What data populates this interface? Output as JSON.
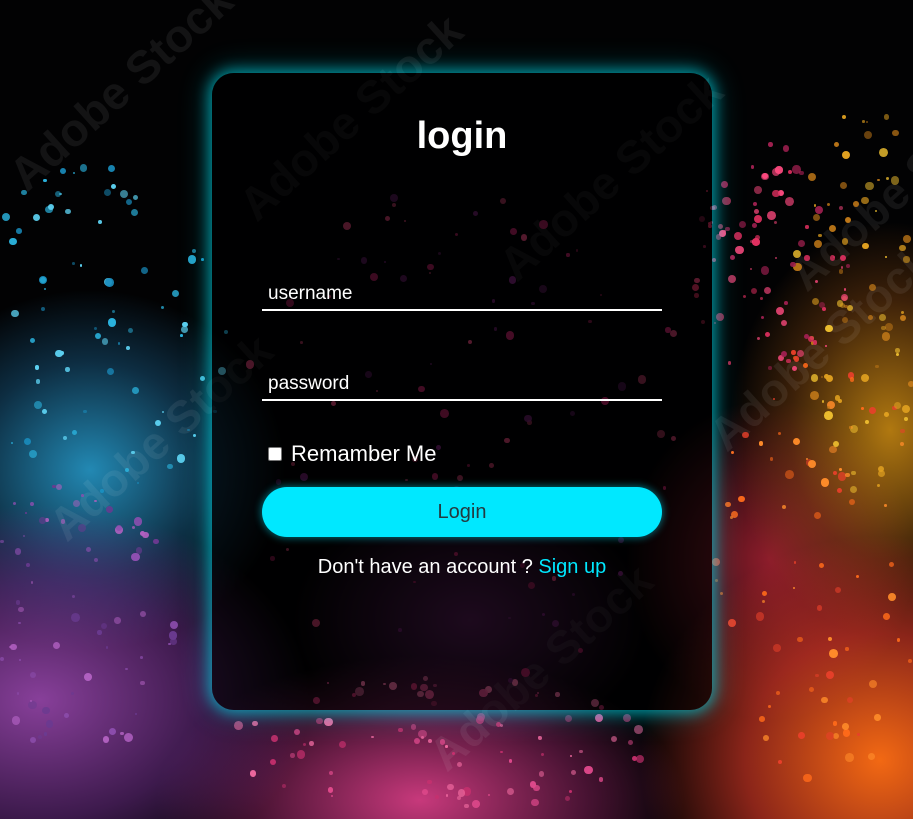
{
  "watermark": "Adobe Stock",
  "form": {
    "title": "login",
    "username_placeholder": "username",
    "password_placeholder": "password",
    "remember_label": "Remamber Me",
    "login_label": "Login",
    "signup_prompt": "Don't have an account ?",
    "signup_link": "Sign up"
  },
  "colors": {
    "accent": "#00e8ff",
    "card_glow": "#00eeff",
    "text": "#ffffff"
  }
}
